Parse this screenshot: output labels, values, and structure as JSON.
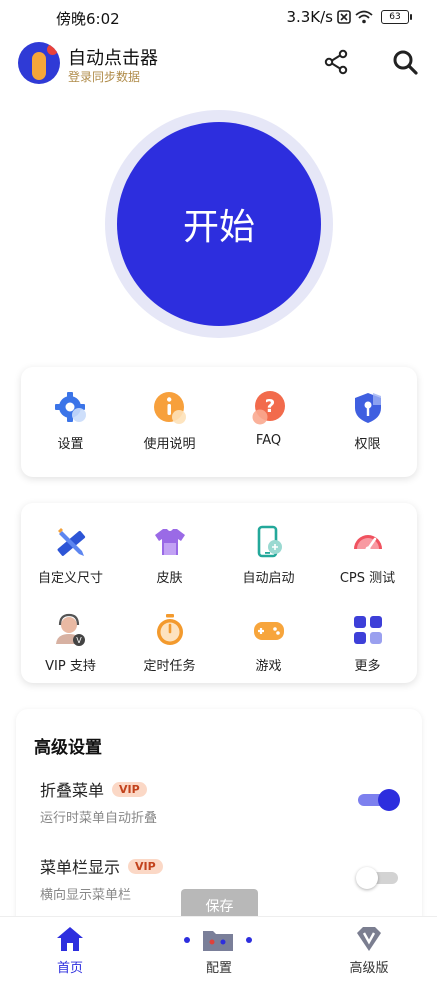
{
  "status_bar": {
    "time": "傍晚6:02",
    "network_speed": "3.3K/s",
    "battery": "63"
  },
  "header": {
    "title": "自动点击器",
    "subtitle": "登录同步数据"
  },
  "start_button": {
    "label": "开始"
  },
  "top_menu": [
    {
      "label": "设置",
      "icon": "gear-icon"
    },
    {
      "label": "使用说明",
      "icon": "info-icon"
    },
    {
      "label": "FAQ",
      "icon": "question-icon"
    },
    {
      "label": "权限",
      "icon": "shield-key-icon"
    }
  ],
  "tools_menu": [
    {
      "label": "自定义尺寸",
      "icon": "ruler-pencil-icon"
    },
    {
      "label": "皮肤",
      "icon": "shirt-icon"
    },
    {
      "label": "自动启动",
      "icon": "phone-link-icon"
    },
    {
      "label": "CPS 测试",
      "icon": "speedometer-icon"
    },
    {
      "label": "VIP 支持",
      "icon": "support-agent-icon"
    },
    {
      "label": "定时任务",
      "icon": "stopwatch-icon"
    },
    {
      "label": "游戏",
      "icon": "gamepad-icon"
    },
    {
      "label": "更多",
      "icon": "grid-icon"
    }
  ],
  "advanced": {
    "title": "高级设置",
    "options": [
      {
        "title": "折叠菜单",
        "badge": "VIP",
        "desc": "运行时菜单自动折叠",
        "enabled": true
      },
      {
        "title": "菜单栏显示",
        "badge": "VIP",
        "desc": "横向显示菜单栏",
        "enabled": false
      }
    ]
  },
  "save_button": {
    "label": "保存"
  },
  "tabs": [
    {
      "label": "首页",
      "active": true
    },
    {
      "label": "配置",
      "active": false
    },
    {
      "label": "高级版",
      "active": false
    }
  ],
  "colors": {
    "accent": "#2d2ede",
    "vip_text": "#c2421c",
    "vip_bg": "#fbd8c6"
  }
}
